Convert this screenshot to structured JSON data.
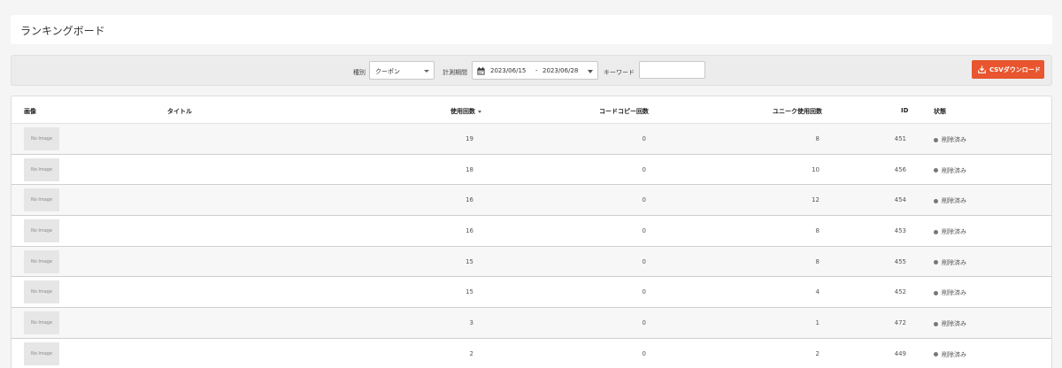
{
  "page": {
    "title": "ランキングボード"
  },
  "filters": {
    "type_label": "種別",
    "type_value": "クーポン",
    "period_label": "計測期間",
    "date_start": "2023/06/15",
    "date_sep": "-",
    "date_end": "2023/06/28",
    "keyword_label": "キーワード",
    "keyword_value": "",
    "csv_button": "CSVダウンロード"
  },
  "colors": {
    "accent": "#e8552e",
    "status_dot": "#777777"
  },
  "table": {
    "headers": {
      "image": "画像",
      "title": "タイトル",
      "use_count": "使用回数",
      "code_copy": "コードコピー回数",
      "unique_use": "ユニーク使用回数",
      "id": "ID",
      "status": "状態"
    },
    "rows": [
      {
        "image": "No Image",
        "title": "",
        "use_count": "19",
        "code_copy": "0",
        "unique_use": "8",
        "id": "451",
        "status": "削除済み"
      },
      {
        "image": "No Image",
        "title": "",
        "use_count": "18",
        "code_copy": "0",
        "unique_use": "10",
        "id": "456",
        "status": "削除済み"
      },
      {
        "image": "No Image",
        "title": "",
        "use_count": "16",
        "code_copy": "0",
        "unique_use": "12",
        "id": "454",
        "status": "削除済み"
      },
      {
        "image": "No Image",
        "title": "",
        "use_count": "16",
        "code_copy": "0",
        "unique_use": "8",
        "id": "453",
        "status": "削除済み"
      },
      {
        "image": "No Image",
        "title": "",
        "use_count": "15",
        "code_copy": "0",
        "unique_use": "8",
        "id": "455",
        "status": "削除済み"
      },
      {
        "image": "No Image",
        "title": "",
        "use_count": "15",
        "code_copy": "0",
        "unique_use": "4",
        "id": "452",
        "status": "削除済み"
      },
      {
        "image": "No Image",
        "title": "",
        "use_count": "3",
        "code_copy": "0",
        "unique_use": "1",
        "id": "472",
        "status": "削除済み"
      },
      {
        "image": "No Image",
        "title": "",
        "use_count": "2",
        "code_copy": "0",
        "unique_use": "2",
        "id": "449",
        "status": "削除済み"
      }
    ]
  }
}
